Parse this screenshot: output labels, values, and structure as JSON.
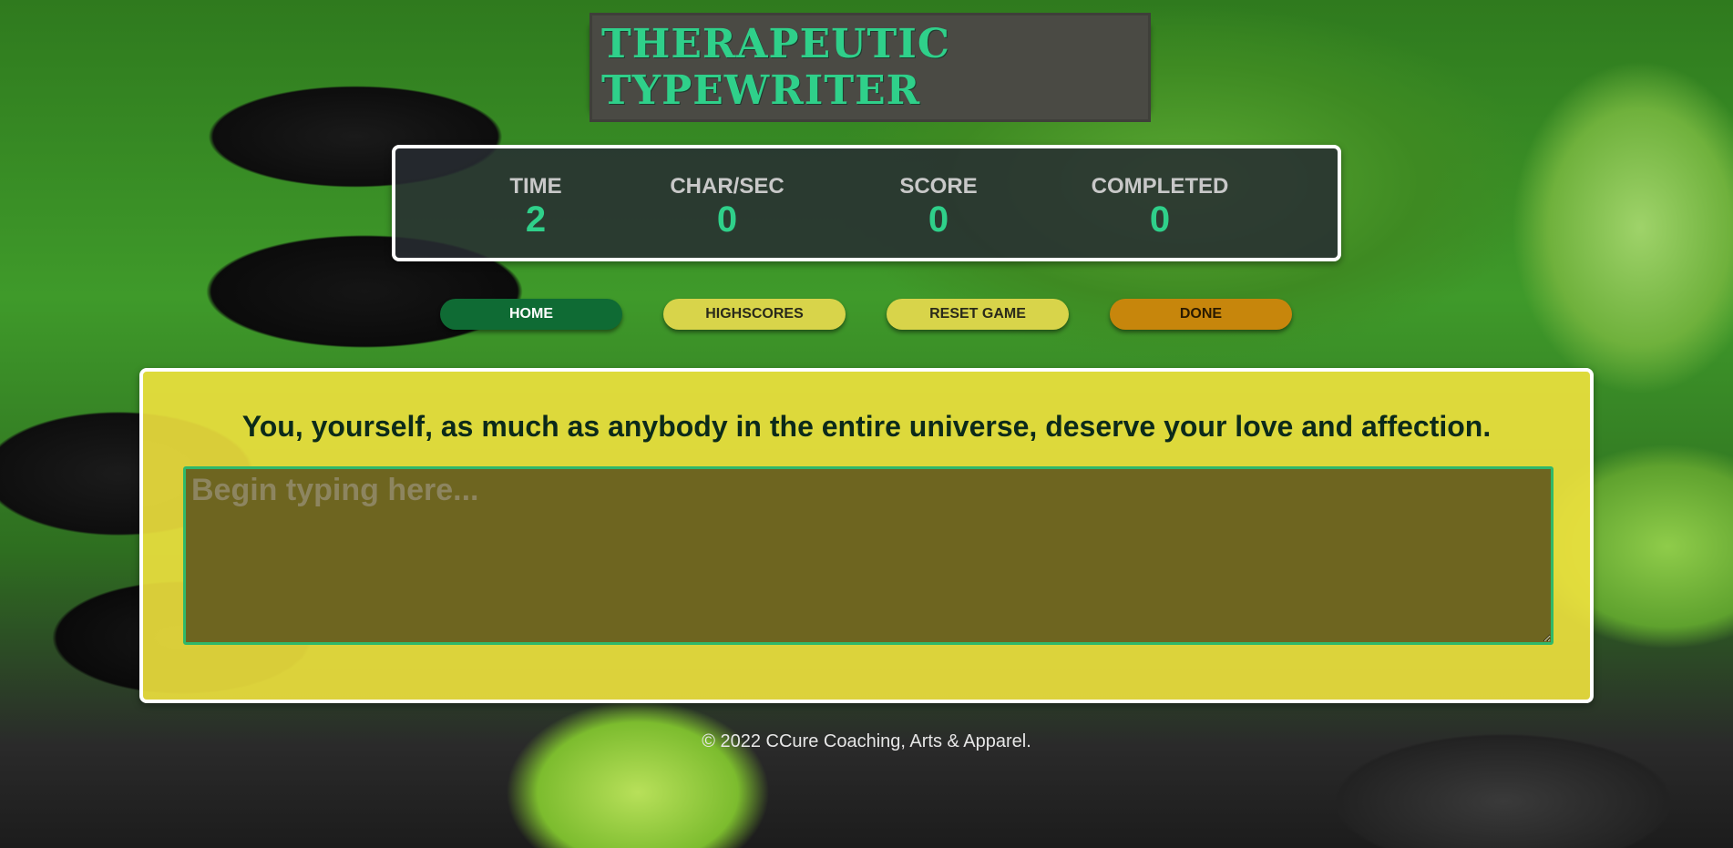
{
  "header": {
    "title": "THERAPEUTIC TYPEWRITER"
  },
  "stats": {
    "time_label": "TIME",
    "time_value": "2",
    "chars_label": "CHAR/SEC",
    "chars_value": "0",
    "score_label": "SCORE",
    "score_value": "0",
    "completed_label": "COMPLETED",
    "completed_value": "0"
  },
  "nav": {
    "home_label": "HOME",
    "highscores_label": "HIGHSCORES",
    "reset_label": "RESET GAME",
    "done_label": "DONE"
  },
  "main": {
    "quote": "You, yourself, as much as anybody in the entire universe, deserve your love and affection.",
    "typing_value": "",
    "typing_placeholder": "Begin typing here..."
  },
  "footer": {
    "copyright": "© 2022 CCure Coaching, Arts & Apparel."
  },
  "colors": {
    "accent_green": "#2fd08a",
    "home_button": "#0f6b34",
    "secondary_button": "#d8d44a",
    "done_button": "#c7860c",
    "main_panel": "#f0e23e"
  }
}
